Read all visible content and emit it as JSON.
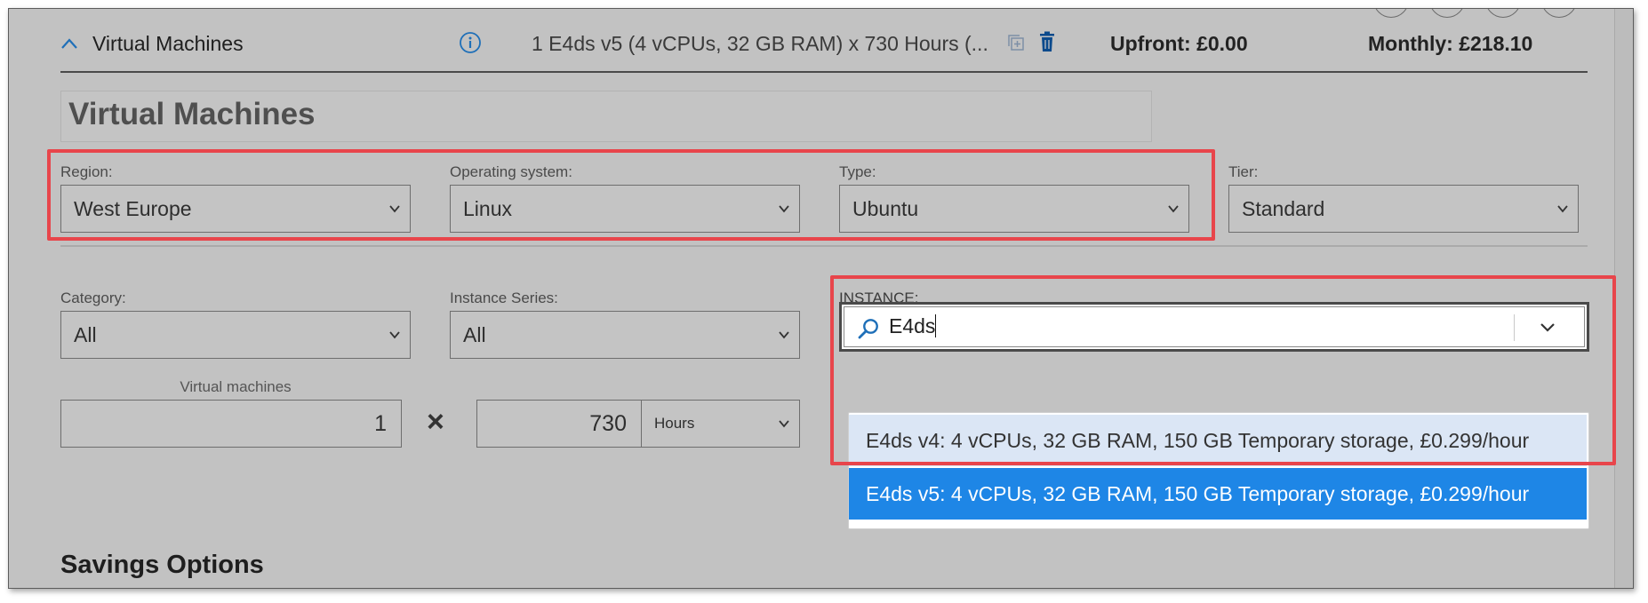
{
  "header": {
    "section_title": "Virtual Machines",
    "summary": "1 E4ds v5 (4 vCPUs, 32 GB RAM) x 730 Hours (...",
    "upfront": "Upfront: £0.00",
    "monthly": "Monthly: £218.10"
  },
  "panel": {
    "title": "Virtual Machines"
  },
  "filters": {
    "region": {
      "label": "Region:",
      "value": "West Europe"
    },
    "os": {
      "label": "Operating system:",
      "value": "Linux"
    },
    "type": {
      "label": "Type:",
      "value": "Ubuntu"
    },
    "tier": {
      "label": "Tier:",
      "value": "Standard"
    },
    "category": {
      "label": "Category:",
      "value": "All"
    },
    "series": {
      "label": "Instance Series:",
      "value": "All"
    }
  },
  "instance": {
    "label": "INSTANCE:",
    "search_value": "E4ds",
    "options": [
      {
        "label": "E4ds v4: 4 vCPUs, 32 GB RAM, 150 GB Temporary storage, £0.299/hour",
        "selected": false
      },
      {
        "label": "E4ds v5: 4 vCPUs, 32 GB RAM, 150 GB Temporary storage, £0.299/hour",
        "selected": true
      }
    ]
  },
  "quantity": {
    "vm_label": "Virtual machines",
    "vm_count": "1",
    "multiply": "×",
    "hours_value": "730",
    "hours_unit": "Hours"
  },
  "savings": {
    "heading": "Savings Options"
  },
  "colors": {
    "highlight_border": "#e8454b",
    "selected_option_bg": "#1e86e6",
    "hover_option_bg": "#dbe6f5",
    "icon_blue": "#1e6fb8",
    "trash_blue": "#0b4a8c"
  }
}
